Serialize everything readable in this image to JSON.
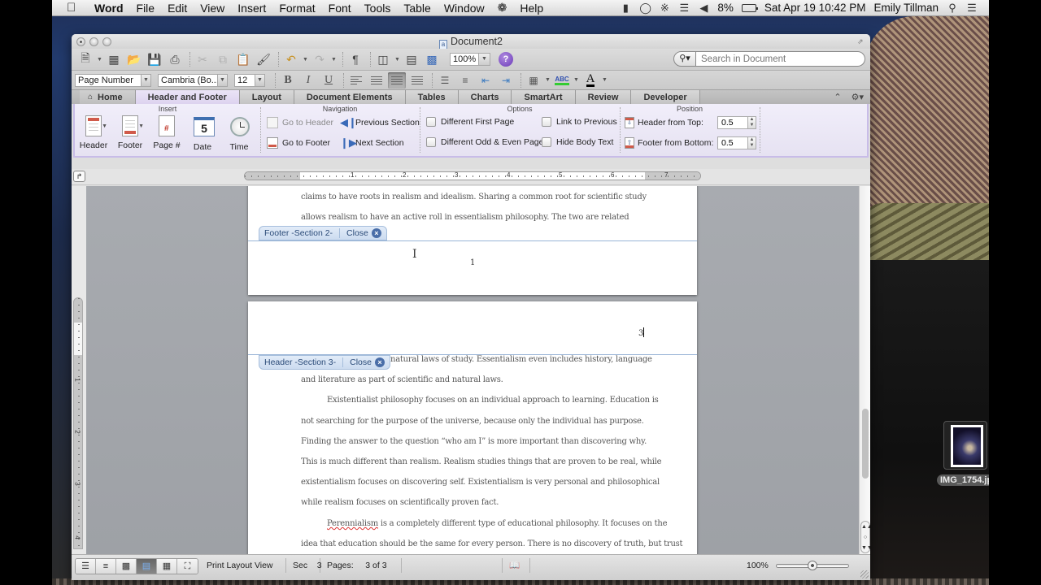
{
  "menubar": {
    "app": "Word",
    "items": [
      "File",
      "Edit",
      "View",
      "Insert",
      "Format",
      "Font",
      "Tools",
      "Table",
      "Window",
      "Help"
    ],
    "status": {
      "battery": "8%",
      "datetime": "Sat Apr 19  10:42 PM",
      "user": "Emily Tillman"
    }
  },
  "window": {
    "title": "Document2"
  },
  "toolbar": {
    "zoom": "100%",
    "help": "?",
    "search_placeholder": "Search in Document"
  },
  "format_toolbar": {
    "style": "Page Number",
    "font": "Cambria (Bo...",
    "size": "12",
    "bold": "B",
    "italic": "I",
    "underline": "U",
    "font_color": "A",
    "highlight": "ABC"
  },
  "ribbon": {
    "tabs": [
      "Home",
      "Header and Footer",
      "Layout",
      "Document Elements",
      "Tables",
      "Charts",
      "SmartArt",
      "Review",
      "Developer"
    ],
    "active_tab": "Header and Footer",
    "groups": {
      "insert": {
        "title": "Insert",
        "buttons": [
          "Header",
          "Footer",
          "Page #",
          "Date",
          "Time"
        ],
        "date_day": "5"
      },
      "navigation": {
        "title": "Navigation",
        "go_to_header": "Go to Header",
        "go_to_footer": "Go to Footer",
        "previous_section": "Previous Section",
        "next_section": "Next Section"
      },
      "options": {
        "title": "Options",
        "different_first_page": "Different First Page",
        "different_odd_even": "Different Odd & Even Pages",
        "link_to_previous": "Link to Previous",
        "hide_body_text": "Hide Body Text"
      },
      "position": {
        "title": "Position",
        "header_from_top_label": "Header from Top:",
        "header_from_top_value": "0.5",
        "footer_from_bottom_label": "Footer from Bottom:",
        "footer_from_bottom_value": "0.5"
      }
    }
  },
  "ruler": {
    "h_numbers": [
      "1",
      "2",
      "3",
      "4",
      "5",
      "6",
      "7"
    ],
    "v_numbers": [
      "1",
      "2",
      "3",
      "4"
    ]
  },
  "document": {
    "page2_lines": [
      "claims to have roots in realism and idealism. Sharing a common root for scientific study",
      "allows realism to have an active roll in essentialism philosophy. The two are related"
    ],
    "footer_tag": "Footer -Section 2-",
    "footer_close": "Close",
    "footer_page_number": "1",
    "header_tag": "Header -Section 3-",
    "header_close": "Close",
    "header_page_number": "3",
    "page3_lines": [
      "natural laws of study. Essentialism even includes history, language",
      "and literature as part of scientific and natural laws.",
      "Existentialist philosophy focuses on an individual approach to learning. Education is",
      "not searching for the purpose of the universe, because only the individual has purpose.",
      "Finding the answer to the question “who am I” is more important than discovering why.",
      "This is much different than realism. Realism studies things that are proven to be real, while",
      "existentialism focuses on discovering self. Existentialism is very personal and philosophical",
      "while realism focuses on scientifically proven fact."
    ],
    "perennialism_word": "Perennialism",
    "perennialism_rest": " is a completely different type of educational philosophy. It focuses on the",
    "last_line": "idea that education should be the same for every person. There is no discovery of truth, but trust"
  },
  "statusbar": {
    "view": "Print Layout View",
    "sec_label": "Sec",
    "sec_value": "3",
    "pages_label": "Pages:",
    "pages_value": "3 of 3",
    "zoom": "100%",
    "zoom_level": 0.5
  },
  "desktop": {
    "file_name": "IMG_1754.jp"
  }
}
